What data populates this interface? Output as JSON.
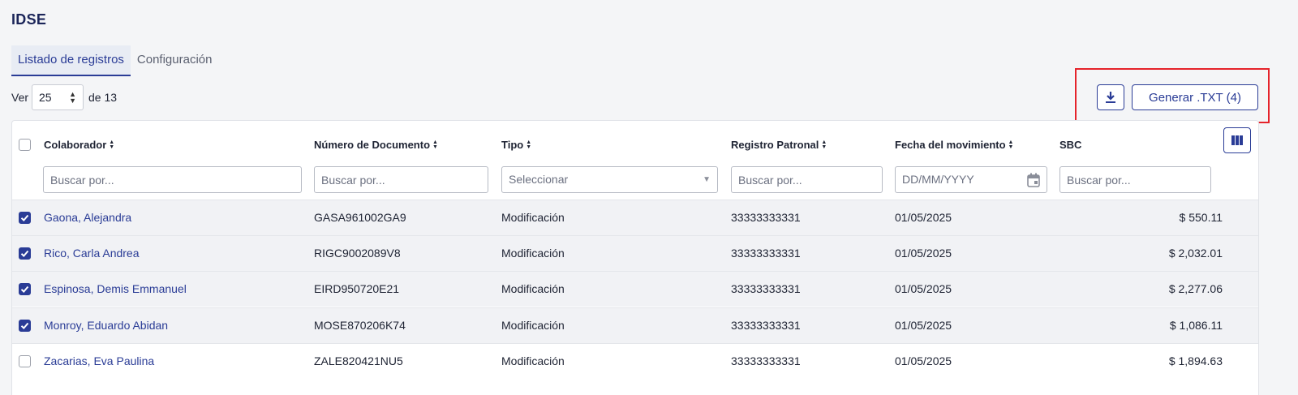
{
  "page": {
    "title": "IDSE"
  },
  "tabs": [
    {
      "label": "Listado de registros",
      "active": true
    },
    {
      "label": "Configuración",
      "active": false
    }
  ],
  "pagination": {
    "prefix": "Ver",
    "page_size": "25",
    "suffix": "de 13"
  },
  "actions": {
    "download_icon": "download-icon",
    "generate_label": "Generar .TXT (4)"
  },
  "colors": {
    "accent": "#2a3c96",
    "highlight": "#e5232b",
    "selected_row": "#f1f2f5"
  },
  "table": {
    "columns": [
      {
        "label": "Colaborador",
        "sortable": true
      },
      {
        "label": "Número de Documento",
        "sortable": true
      },
      {
        "label": "Tipo",
        "sortable": true
      },
      {
        "label": "Registro Patronal",
        "sortable": true
      },
      {
        "label": "Fecha del movimiento",
        "sortable": true
      },
      {
        "label": "SBC",
        "sortable": false
      }
    ],
    "filters": {
      "colaborador": "Buscar por...",
      "documento": "Buscar por...",
      "tipo": "Seleccionar",
      "registro": "Buscar por...",
      "fecha": "DD/MM/YYYY",
      "sbc": "Buscar por..."
    },
    "rows": [
      {
        "checked": true,
        "name": "Gaona, Alejandra",
        "document": "GASA961002GA9",
        "type": "Modificación",
        "registro": "33333333331",
        "date": "01/05/2025",
        "sbc": "$ 550.11"
      },
      {
        "checked": true,
        "name": "Rico, Carla Andrea",
        "document": "RIGC9002089V8",
        "type": "Modificación",
        "registro": "33333333331",
        "date": "01/05/2025",
        "sbc": "$ 2,032.01"
      },
      {
        "checked": true,
        "name": "Espinosa, Demis Emmanuel",
        "document": "EIRD950720E21",
        "type": "Modificación",
        "registro": "33333333331",
        "date": "01/05/2025",
        "sbc": "$ 2,277.06"
      },
      {
        "checked": true,
        "name": "Monroy, Eduardo Abidan",
        "document": "MOSE870206K74",
        "type": "Modificación",
        "registro": "33333333331",
        "date": "01/05/2025",
        "sbc": "$ 1,086.11"
      },
      {
        "checked": false,
        "name": "Zacarias, Eva Paulina",
        "document": "ZALE820421NU5",
        "type": "Modificación",
        "registro": "33333333331",
        "date": "01/05/2025",
        "sbc": "$ 1,894.63"
      }
    ]
  }
}
